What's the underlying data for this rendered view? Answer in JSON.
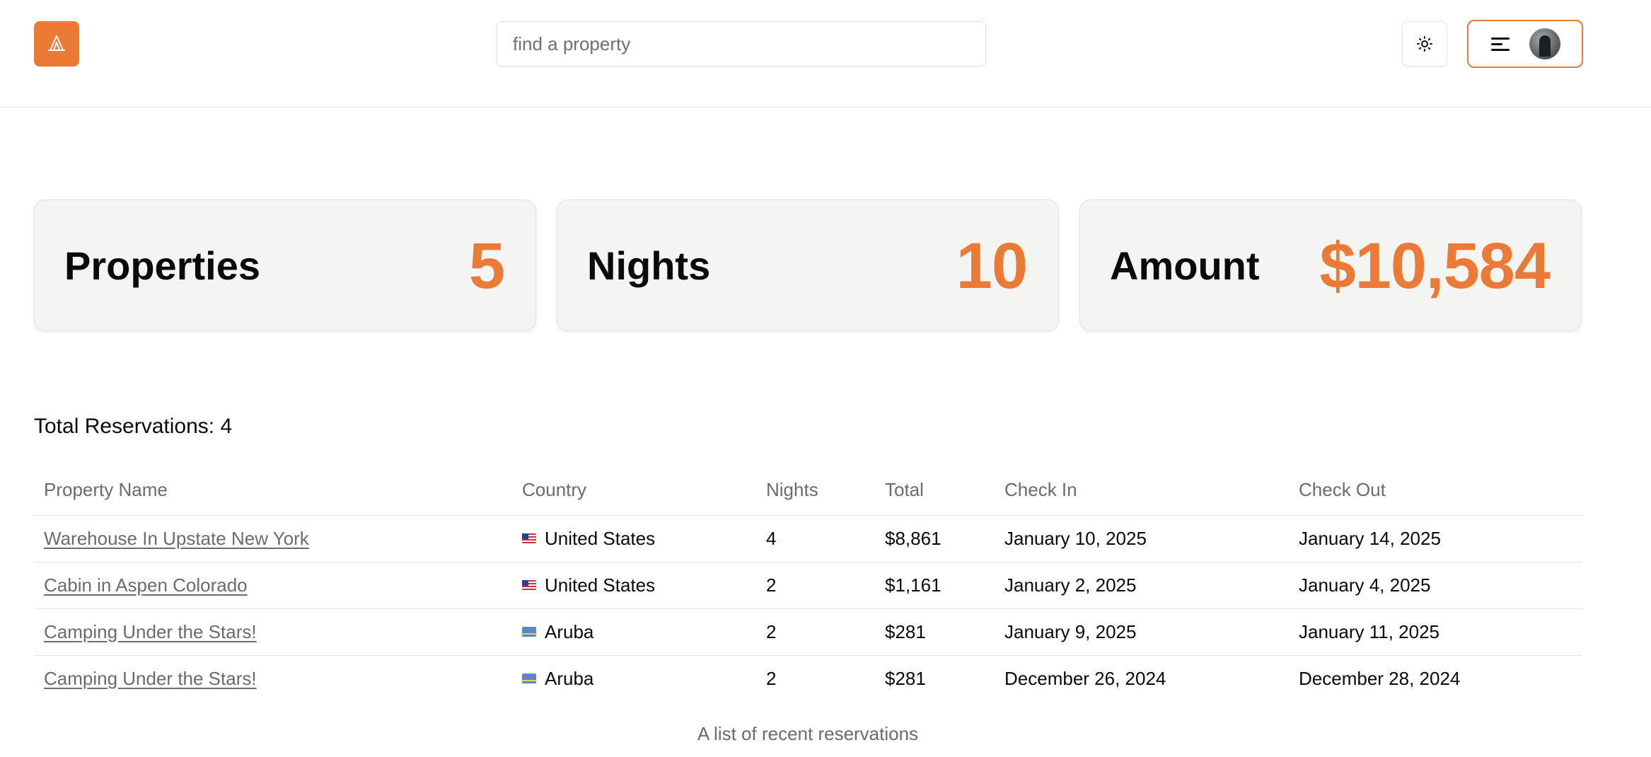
{
  "header": {
    "logo_icon": "tent-icon",
    "search_placeholder": "find a property",
    "theme_toggle_icon": "sun-icon",
    "menu_icon": "hamburger-icon",
    "brand_color": "#ea7a36"
  },
  "stats": [
    {
      "label": "Properties",
      "value": "5"
    },
    {
      "label": "Nights",
      "value": "10"
    },
    {
      "label": "Amount",
      "value": "$10,584"
    }
  ],
  "reservations": {
    "total_label": "Total Reservations: 4",
    "columns": [
      "Property Name",
      "Country",
      "Nights",
      "Total",
      "Check In",
      "Check Out"
    ],
    "rows": [
      {
        "property": "Warehouse In Upstate New York",
        "flag": "us-flag-icon",
        "country": "United States",
        "nights": "4",
        "total": "$8,861",
        "check_in": "January 10, 2025",
        "check_out": "January 14, 2025"
      },
      {
        "property": "Cabin in Aspen Colorado",
        "flag": "us-flag-icon",
        "country": "United States",
        "nights": "2",
        "total": "$1,161",
        "check_in": "January 2, 2025",
        "check_out": "January 4, 2025"
      },
      {
        "property": "Camping Under the Stars!",
        "flag": "aruba-flag-icon",
        "country": "Aruba",
        "nights": "2",
        "total": "$281",
        "check_in": "January 9, 2025",
        "check_out": "January 11, 2025"
      },
      {
        "property": "Camping Under the Stars!",
        "flag": "aruba-flag-icon",
        "country": "Aruba",
        "nights": "2",
        "total": "$281",
        "check_in": "December 26, 2024",
        "check_out": "December 28, 2024"
      }
    ],
    "caption": "A list of recent reservations"
  }
}
